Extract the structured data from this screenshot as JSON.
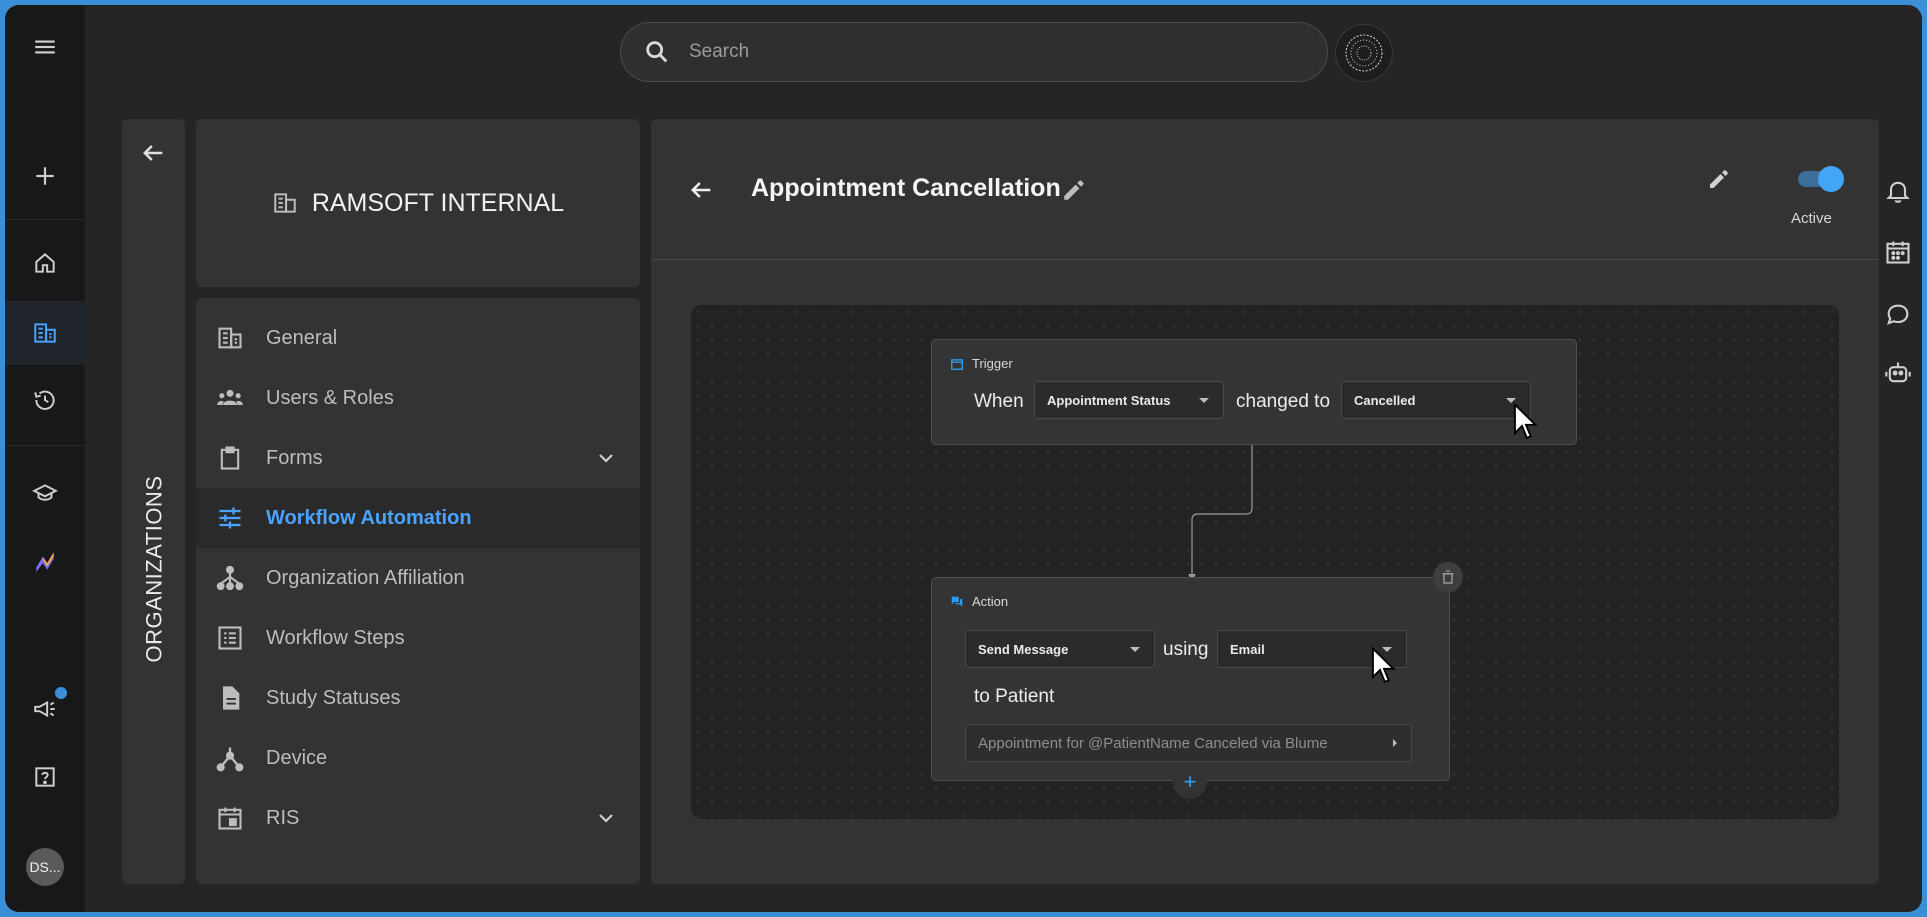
{
  "search": {
    "placeholder": "Search"
  },
  "user": {
    "initials": "DS..."
  },
  "org": {
    "tab_label": "ORGANIZATIONS",
    "name": "RAMSOFT INTERNAL"
  },
  "nav": {
    "items": [
      {
        "label": "General",
        "icon": "building-icon"
      },
      {
        "label": "Users & Roles",
        "icon": "users-icon"
      },
      {
        "label": "Forms",
        "icon": "clipboard-icon",
        "expandable": true
      },
      {
        "label": "Workflow Automation",
        "icon": "sliders-icon",
        "active": true
      },
      {
        "label": "Organization Affiliation",
        "icon": "hierarchy-icon"
      },
      {
        "label": "Workflow Steps",
        "icon": "list-icon"
      },
      {
        "label": "Study Statuses",
        "icon": "document-icon"
      },
      {
        "label": "Device",
        "icon": "device-icon"
      },
      {
        "label": "RIS",
        "icon": "calendar-icon",
        "expandable": true
      }
    ]
  },
  "workflow": {
    "title": "Appointment Cancellation",
    "status_label": "Active",
    "trigger": {
      "header": "Trigger",
      "when": "When",
      "field": "Appointment Status",
      "changed_to": "changed to",
      "value": "Cancelled"
    },
    "action": {
      "header": "Action",
      "action_type": "Send Message",
      "using": "using",
      "channel": "Email",
      "recipient": "to Patient",
      "message": "Appointment for @PatientName Canceled via Blume"
    },
    "add_step": "+"
  },
  "colors": {
    "accent": "#42a5f5",
    "background": "#252525",
    "panel": "#333333"
  }
}
